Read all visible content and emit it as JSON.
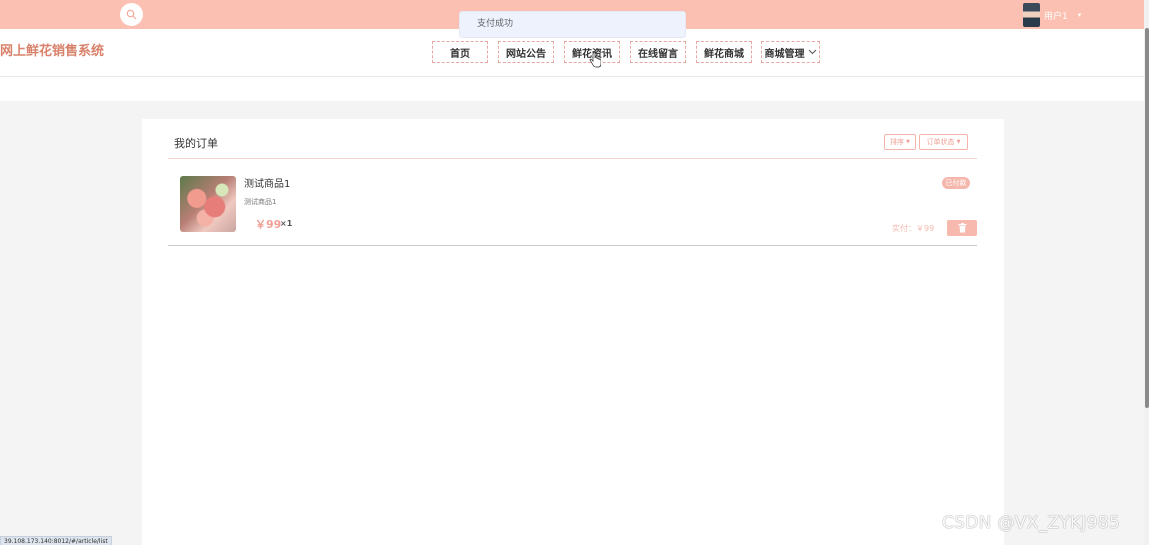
{
  "topbar": {
    "user_name": "用户1",
    "user_caret": "▾"
  },
  "toast": {
    "message": "支付成功"
  },
  "header": {
    "site_title": "网上鲜花销售系统",
    "nav": [
      {
        "label": "首页"
      },
      {
        "label": "网站公告"
      },
      {
        "label": "鲜花资讯"
      },
      {
        "label": "在线留言"
      },
      {
        "label": "鲜花商城"
      },
      {
        "label": "商城管理"
      }
    ]
  },
  "orders": {
    "title": "我的订单",
    "sort_label": "排序",
    "status_filter_label": "订单状态",
    "items": [
      {
        "name": "测试商品1",
        "subtitle": "测试商品1",
        "price": "￥99",
        "quantity": "×1",
        "status": "已付款",
        "paid_label": "实付：￥99"
      }
    ]
  },
  "status_url": "39.108.173.140:8012/#/article/list",
  "watermark": "CSDN @VX_ZYKJ985",
  "colors": {
    "topbar": "#fbc0b1",
    "accent": "#f0a096",
    "title": "#d9826b"
  }
}
